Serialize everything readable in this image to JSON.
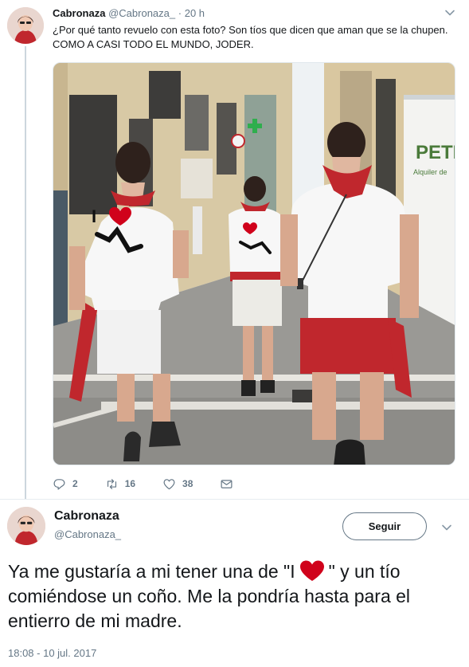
{
  "parent_tweet": {
    "name": "Cabronaza",
    "handle": "@Cabronaza_",
    "separator": "·",
    "time": "20 h",
    "text": "¿Por qué tanto revuelo con esta foto? Son tíos que dicen que aman que se la chupen. COMO A CASI TODO EL MUNDO, JODER.",
    "photo": {
      "shirt_print_letter": "I",
      "truck_lettering": "PETIT",
      "truck_sub_lettering": "Alquiler de"
    },
    "actions": {
      "reply_count": "2",
      "retweet_count": "16",
      "like_count": "38"
    }
  },
  "main_tweet": {
    "name": "Cabronaza",
    "handle": "@Cabronaza_",
    "follow_label": "Seguir",
    "text_part1": "Ya me gustaría a mi tener una de \"I",
    "text_part2": "\" y un tío comiéndose un coño. Me la pondría hasta para el entierro de mi madre.",
    "timestamp": "18:08 - 10 jul. 2017"
  },
  "icons": {
    "reply": "reply-icon",
    "retweet": "retweet-icon",
    "like": "heart-icon",
    "dm": "envelope-icon",
    "more": "chevron-down-icon",
    "inline_emoji": "red-heart-emoji"
  },
  "colors": {
    "text": "#14171a",
    "secondary": "#657786",
    "line": "#ccd6dd",
    "heart": "#d0021b"
  }
}
